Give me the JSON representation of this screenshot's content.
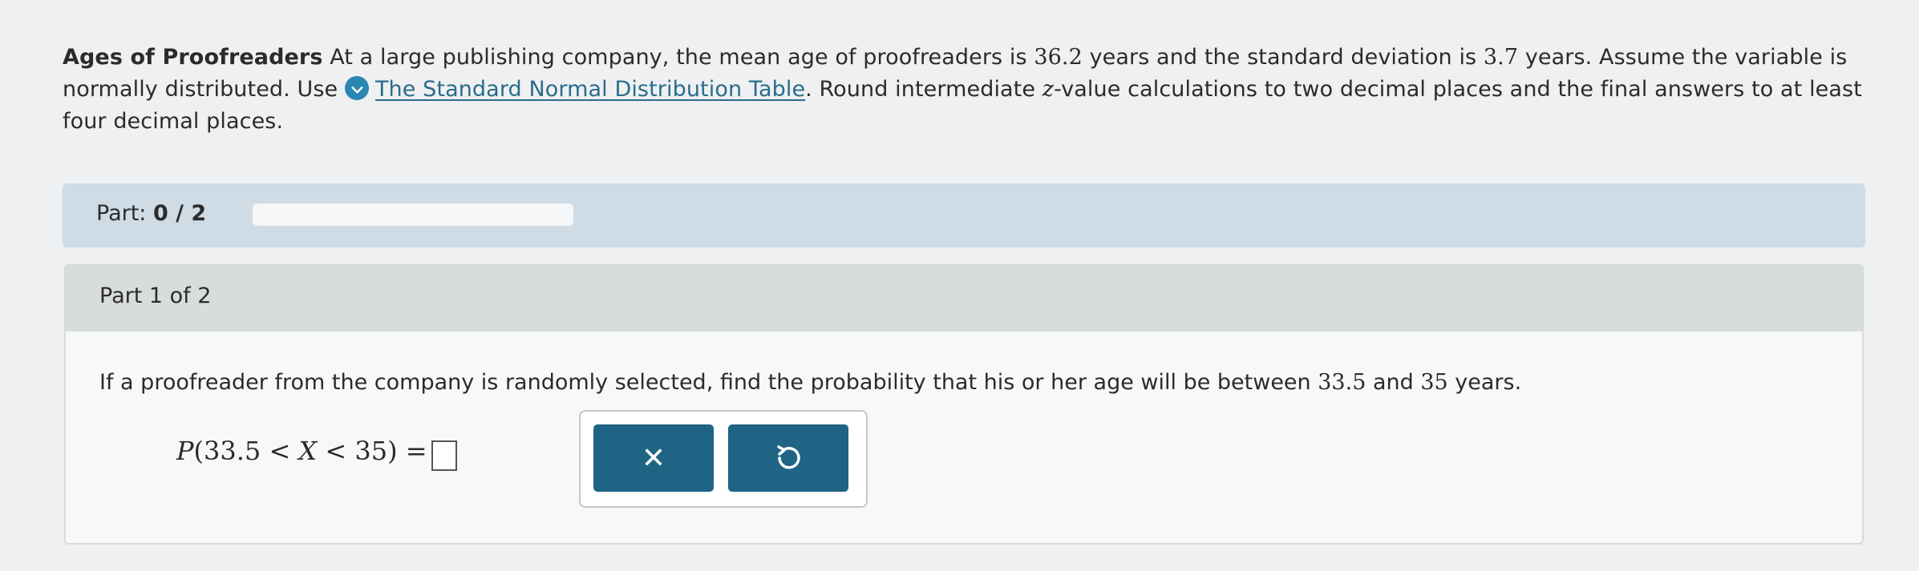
{
  "problem": {
    "title": "Ages of Proofreaders",
    "text_1": " At a large publishing company, the mean age of proofreaders is ",
    "mean": "36.2",
    "text_2": " years and the standard deviation is ",
    "sd": "3.7",
    "text_3": " years. Assume the variable is normally distributed. Use ",
    "table_link": "The Standard Normal Distribution Table",
    "text_4": ". Round intermediate ",
    "z_var": "z",
    "text_5": "-value calculations to two decimal places and the final answers to at least four decimal places."
  },
  "progress": {
    "label": "Part: ",
    "count": "0 / 2",
    "fraction": 0.0
  },
  "part": {
    "title": "Part 1 of 2",
    "question_1": "If a proofreader from the company is randomly selected, find the probability that his or her age will be between ",
    "low": "33.5",
    "question_2": " and ",
    "high": "35",
    "question_3": " years.",
    "expression_p": "P",
    "expression_body": "(33.5 < ",
    "expression_x": "X",
    "expression_tail": " < 35) = ",
    "answer_value": ""
  },
  "buttons": {
    "clear": "✕"
  },
  "colors": {
    "accent": "#1f6385",
    "link": "#2a6c8c",
    "progress_bg": "#cfdce6"
  }
}
